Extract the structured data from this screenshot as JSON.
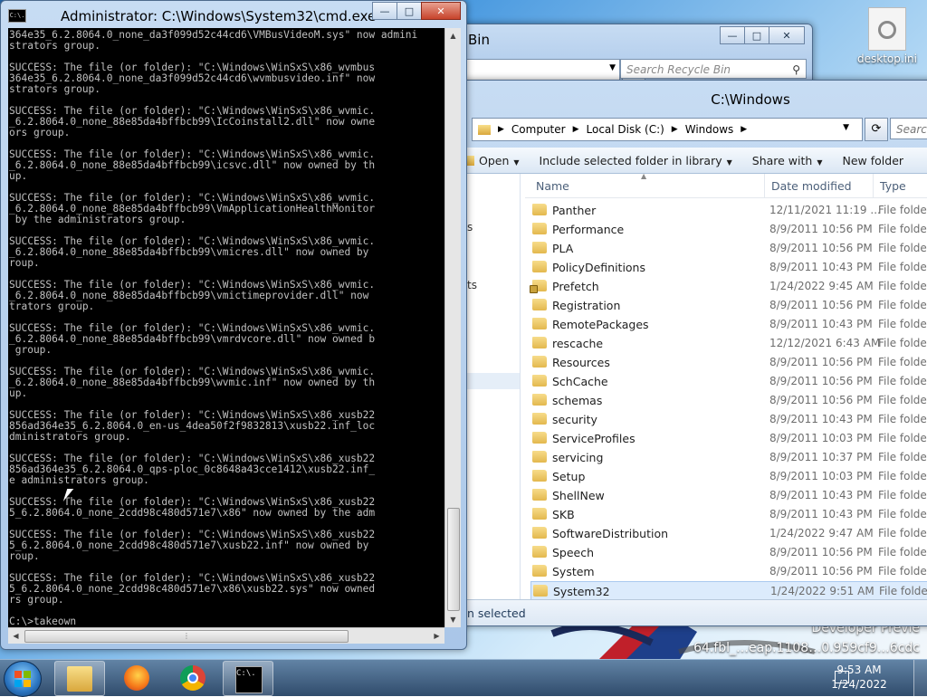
{
  "desktop": {
    "icon_label": "desktop.ini",
    "watermark_line1": "Developer Previe",
    "watermark_line2": "64.fbl_…eap.1108…0.959cf9…6cdc"
  },
  "recycle_window": {
    "title": "Bin",
    "search_placeholder": "Search Recycle Bin"
  },
  "explorer": {
    "title": "C:\\Windows",
    "breadcrumb": [
      "Computer",
      "Local Disk (C:)",
      "Windows"
    ],
    "search_placeholder": "Searc",
    "toolbar": {
      "open": "Open",
      "include": "Include selected folder in library",
      "share": "Share with",
      "new_folder": "New folder"
    },
    "columns": {
      "name": "Name",
      "date": "Date modified",
      "type": "Type"
    },
    "navpane": {
      "item1": "s",
      "item2": "ts"
    },
    "rows": [
      {
        "name": "Panther",
        "date": "12/11/2021 11:19 ...",
        "type": "File folder"
      },
      {
        "name": "Performance",
        "date": "8/9/2011 10:56 PM",
        "type": "File folder"
      },
      {
        "name": "PLA",
        "date": "8/9/2011 10:56 PM",
        "type": "File folder"
      },
      {
        "name": "PolicyDefinitions",
        "date": "8/9/2011 10:43 PM",
        "type": "File folder"
      },
      {
        "name": "Prefetch",
        "date": "1/24/2022 9:45 AM",
        "type": "File folder",
        "locked": true
      },
      {
        "name": "Registration",
        "date": "8/9/2011 10:56 PM",
        "type": "File folder"
      },
      {
        "name": "RemotePackages",
        "date": "8/9/2011 10:43 PM",
        "type": "File folder"
      },
      {
        "name": "rescache",
        "date": "12/12/2021 6:43 AM",
        "type": "File folder"
      },
      {
        "name": "Resources",
        "date": "8/9/2011 10:56 PM",
        "type": "File folder"
      },
      {
        "name": "SchCache",
        "date": "8/9/2011 10:56 PM",
        "type": "File folder"
      },
      {
        "name": "schemas",
        "date": "8/9/2011 10:56 PM",
        "type": "File folder"
      },
      {
        "name": "security",
        "date": "8/9/2011 10:43 PM",
        "type": "File folder"
      },
      {
        "name": "ServiceProfiles",
        "date": "8/9/2011 10:03 PM",
        "type": "File folder"
      },
      {
        "name": "servicing",
        "date": "8/9/2011 10:37 PM",
        "type": "File folder"
      },
      {
        "name": "Setup",
        "date": "8/9/2011 10:03 PM",
        "type": "File folder"
      },
      {
        "name": "ShellNew",
        "date": "8/9/2011 10:43 PM",
        "type": "File folder"
      },
      {
        "name": "SKB",
        "date": "8/9/2011 10:43 PM",
        "type": "File folder"
      },
      {
        "name": "SoftwareDistribution",
        "date": "1/24/2022 9:47 AM",
        "type": "File folder"
      },
      {
        "name": "Speech",
        "date": "8/9/2011 10:56 PM",
        "type": "File folder"
      },
      {
        "name": "System",
        "date": "8/9/2011 10:56 PM",
        "type": "File folder"
      },
      {
        "name": "System32",
        "date": "1/24/2022 9:51 AM",
        "type": "File folder",
        "selected": true
      }
    ],
    "status": "n selected"
  },
  "cmd": {
    "title": "Administrator: C:\\Windows\\System32\\cmd.exe",
    "icon_text": "C:\\.",
    "output": "364e35_6.2.8064.0_none_da3f099d52c44cd6\\VMBusVideoM.sys\" now admini\nstrators group.\n\nSUCCESS: The file (or folder): \"C:\\Windows\\WinSxS\\x86_wvmbus\n364e35_6.2.8064.0_none_da3f099d52c44cd6\\wvmbusvideo.inf\" now\nstrators group.\n\nSUCCESS: The file (or folder): \"C:\\Windows\\WinSxS\\x86_wvmic.\n_6.2.8064.0_none_88e85da4bffbcb99\\IcCoinstall2.dll\" now owne\nors group.\n\nSUCCESS: The file (or folder): \"C:\\Windows\\WinSxS\\x86_wvmic.\n_6.2.8064.0_none_88e85da4bffbcb99\\icsvc.dll\" now owned by th\nup.\n\nSUCCESS: The file (or folder): \"C:\\Windows\\WinSxS\\x86_wvmic.\n_6.2.8064.0_none_88e85da4bffbcb99\\VmApplicationHealthMonitor\n by the administrators group.\n\nSUCCESS: The file (or folder): \"C:\\Windows\\WinSxS\\x86_wvmic.\n_6.2.8064.0_none_88e85da4bffbcb99\\vmicres.dll\" now owned by\nroup.\n\nSUCCESS: The file (or folder): \"C:\\Windows\\WinSxS\\x86_wvmic.\n_6.2.8064.0_none_88e85da4bffbcb99\\vmictimeprovider.dll\" now\ntrators group.\n\nSUCCESS: The file (or folder): \"C:\\Windows\\WinSxS\\x86_wvmic.\n_6.2.8064.0_none_88e85da4bffbcb99\\vmrdvcore.dll\" now owned b\n group.\n\nSUCCESS: The file (or folder): \"C:\\Windows\\WinSxS\\x86_wvmic.\n_6.2.8064.0_none_88e85da4bffbcb99\\wvmic.inf\" now owned by th\nup.\n\nSUCCESS: The file (or folder): \"C:\\Windows\\WinSxS\\x86_xusb22\n856ad364e35_6.2.8064.0_en-us_4dea50f2f9832813\\xusb22.inf_loc\ndministrators group.\n\nSUCCESS: The file (or folder): \"C:\\Windows\\WinSxS\\x86_xusb22\n856ad364e35_6.2.8064.0_qps-ploc_0c8648a43cce1412\\xusb22.inf_\ne administrators group.\n\nSUCCESS: The file (or folder): \"C:\\Windows\\WinSxS\\x86_xusb22\n5_6.2.8064.0_none_2cdd98c480d571e7\\x86\" now owned by the adm\n\nSUCCESS: The file (or folder): \"C:\\Windows\\WinSxS\\x86_xusb22\n5_6.2.8064.0_none_2cdd98c480d571e7\\xusb22.inf\" now owned by\nroup.\n\nSUCCESS: The file (or folder): \"C:\\Windows\\WinSxS\\x86_xusb22\n5_6.2.8064.0_none_2cdd98c480d571e7\\x86\\xusb22.sys\" now owned\nrs group.\n\nC:\\>takeown"
  },
  "taskbar": {
    "time": "9:53 AM",
    "date": "1/24/2022",
    "cmd_icon_text": "C:\\."
  },
  "icons": {
    "search": "search-icon",
    "refresh": "refresh-icon",
    "folder": "folder-icon"
  }
}
